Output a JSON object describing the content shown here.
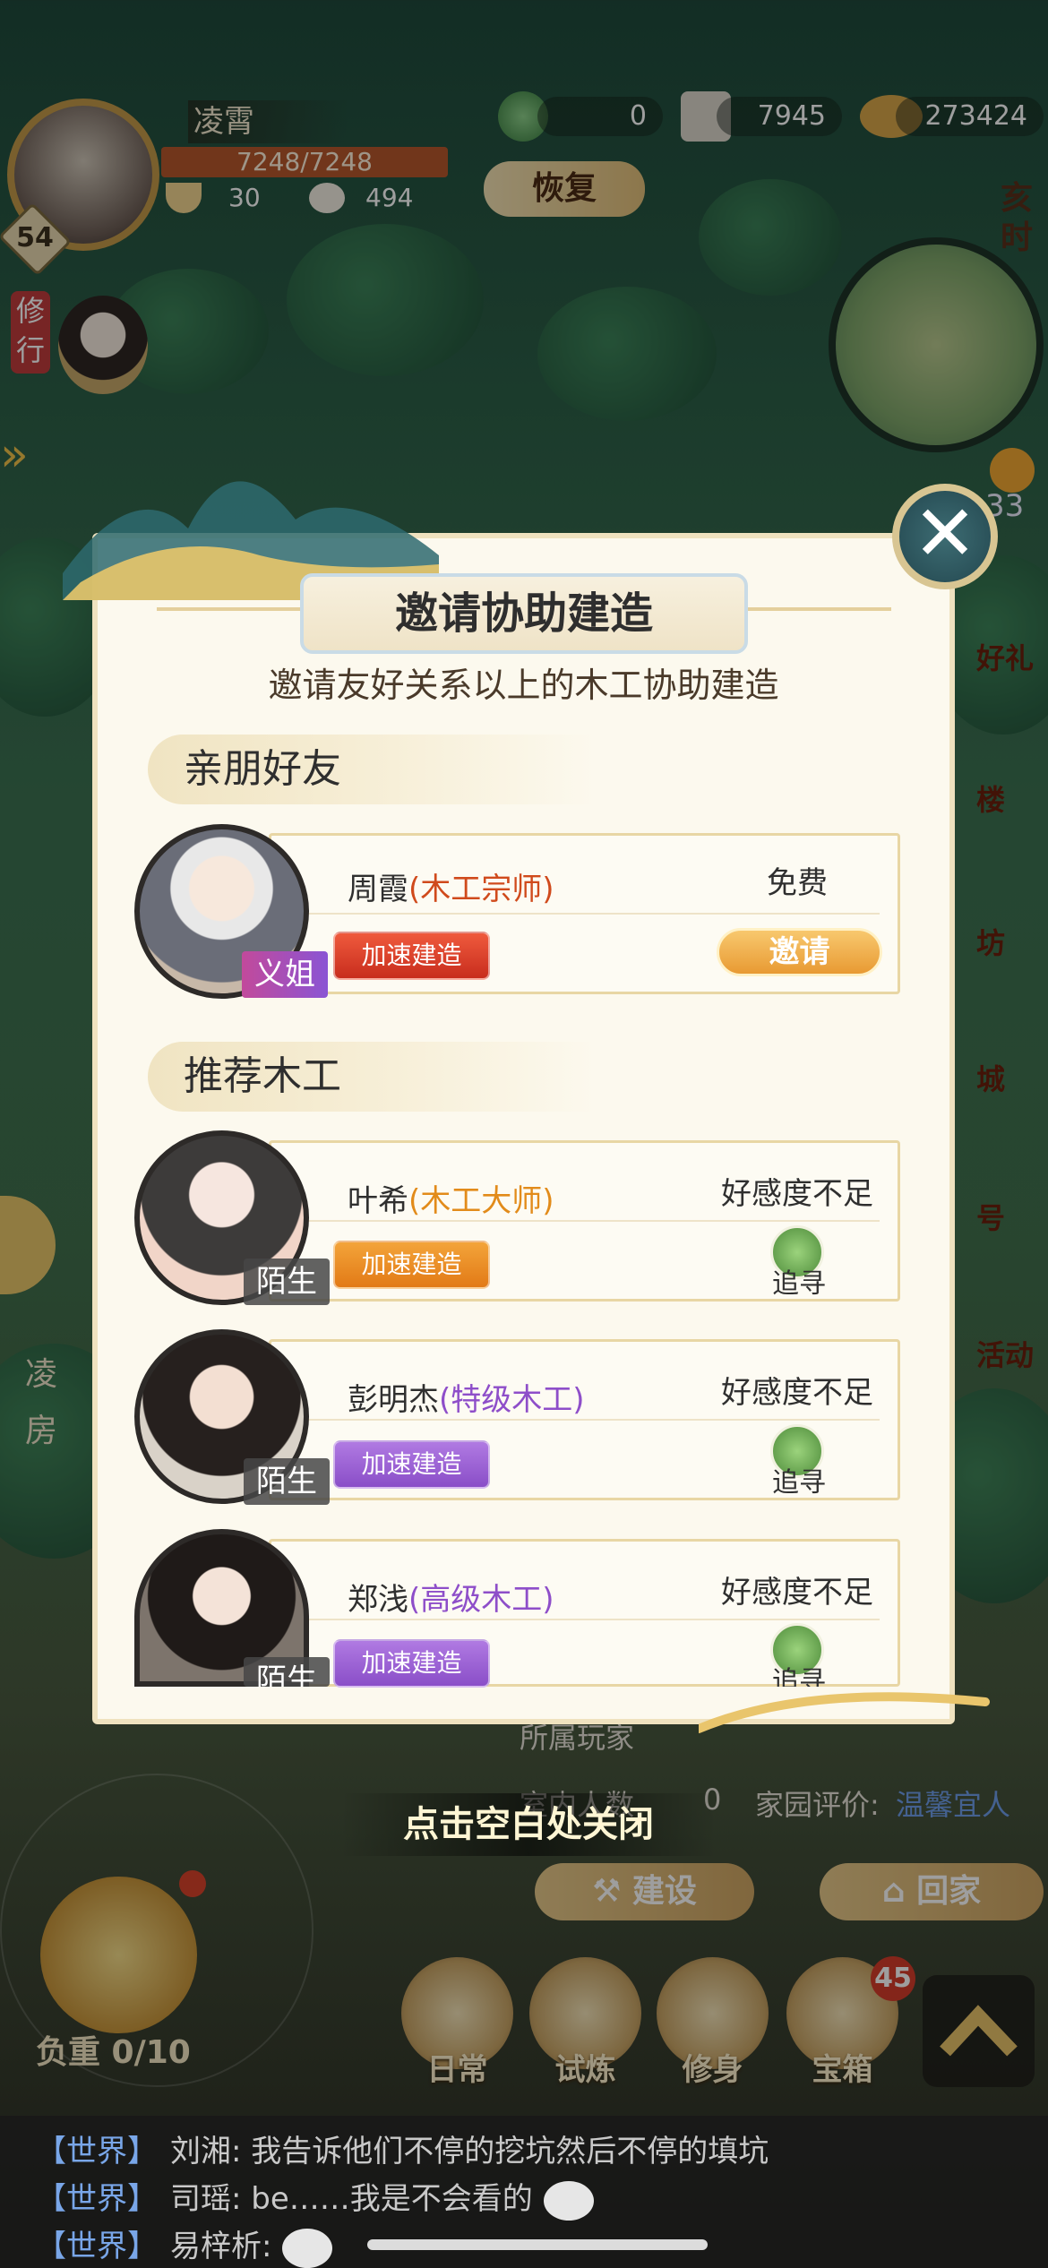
{
  "hud": {
    "player_name": "凌霄",
    "level": "54",
    "hp": "7248/7248",
    "stat_food": "30",
    "stat_bun": "494",
    "res_1": "0",
    "res_2": "7945",
    "res_3": "273424",
    "restore_label": "恢复",
    "time_label": "亥时",
    "side_tag": "修行",
    "weather_num": "33",
    "right_labels": [
      "好礼",
      "楼",
      "坊",
      "城",
      "号",
      "活动"
    ],
    "left_labels": [
      "凌",
      "房"
    ]
  },
  "behind_panel": {
    "owner_label": "所属玩家",
    "count_label": "室内人数",
    "count_value": "0",
    "rating_label": "家园评价:",
    "rating_value": "温馨宜人",
    "build_label": "建设",
    "home_label": "回家"
  },
  "modal": {
    "title": "邀请协助建造",
    "subtitle": "邀请友好关系以上的木工协助建造",
    "section_friends": "亲朋好友",
    "section_recommend": "推荐木工",
    "friends": [
      {
        "name": "周霞",
        "title": "(木工宗师)",
        "relation": "义姐",
        "speed_label": "加速建造",
        "status": "免费",
        "action": "邀请"
      }
    ],
    "recommended": [
      {
        "name": "叶希",
        "title": "(木工大师)",
        "relation": "陌生",
        "speed_label": "加速建造",
        "status": "好感度不足",
        "action": "追寻"
      },
      {
        "name": "彭明杰",
        "title": "(特级木工)",
        "relation": "陌生",
        "speed_label": "加速建造",
        "status": "好感度不足",
        "action": "追寻"
      },
      {
        "name": "郑浅",
        "title": "(高级木工)",
        "relation": "陌生",
        "speed_label": "加速建造",
        "status": "好感度不足",
        "action": "追寻"
      }
    ],
    "close_hint": "点击空白处关闭"
  },
  "bottom": {
    "weight_label": "负重 0/10",
    "nav": [
      "日常",
      "试炼",
      "修身",
      "宝箱"
    ],
    "chest_badge": "45"
  },
  "chat": [
    {
      "channel": "【世界】",
      "text": "刘湘: 我告诉他们不停的挖坑然后不停的填坑"
    },
    {
      "channel": "【世界】",
      "text": "司瑶: be……我是不会看的"
    },
    {
      "channel": "【世界】",
      "text": "易梓析:"
    }
  ],
  "colors": {
    "accent_gold": "#e8b85c",
    "speed_red": "#d8432b",
    "speed_orange": "#e88a22",
    "speed_purple": "#9b63d6",
    "title_red": "#d04a1c",
    "title_orange": "#e28b1a",
    "title_purple": "#8e4ec9",
    "rating_blue": "#4f7fd1"
  }
}
